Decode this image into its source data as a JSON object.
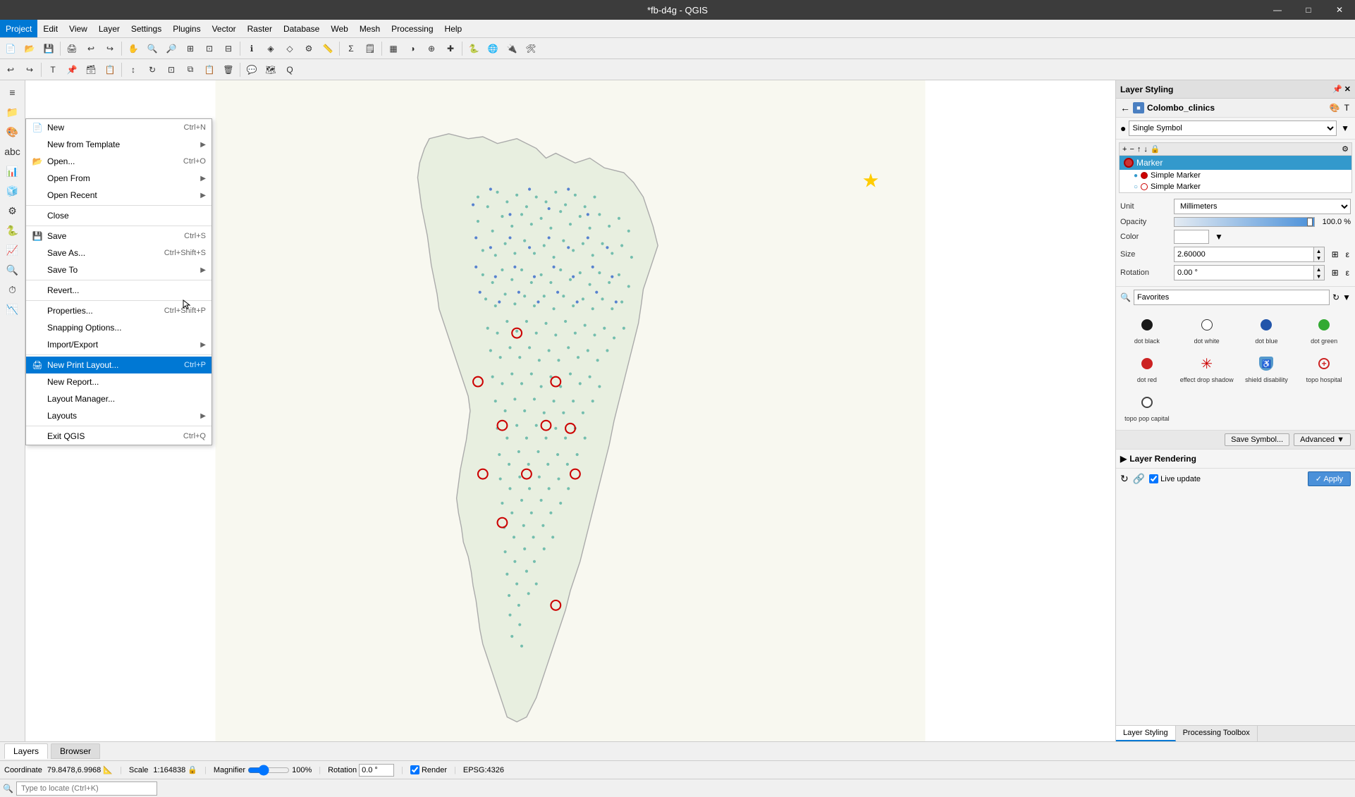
{
  "window": {
    "title": "*fb-d4g - QGIS"
  },
  "window_controls": {
    "minimize": "—",
    "maximize": "□",
    "close": "✕"
  },
  "menubar": {
    "items": [
      "Project",
      "Edit",
      "View",
      "Layer",
      "Settings",
      "Plugins",
      "Vector",
      "Raster",
      "Database",
      "Web",
      "Mesh",
      "Processing",
      "Help"
    ]
  },
  "dropdown": {
    "items": [
      {
        "label": "New",
        "shortcut": "Ctrl+N",
        "icon": "",
        "has_arrow": false,
        "separator_after": false
      },
      {
        "label": "New from Template",
        "shortcut": "",
        "icon": "",
        "has_arrow": true,
        "separator_after": false
      },
      {
        "label": "Open...",
        "shortcut": "Ctrl+O",
        "icon": "",
        "has_arrow": false,
        "separator_after": false
      },
      {
        "label": "Open From",
        "shortcut": "",
        "icon": "",
        "has_arrow": true,
        "separator_after": false
      },
      {
        "label": "Open Recent",
        "shortcut": "",
        "icon": "",
        "has_arrow": true,
        "separator_after": true
      },
      {
        "label": "Close",
        "shortcut": "",
        "icon": "",
        "has_arrow": false,
        "separator_after": true
      },
      {
        "label": "Save",
        "shortcut": "Ctrl+S",
        "icon": "",
        "has_arrow": false,
        "separator_after": false
      },
      {
        "label": "Save As...",
        "shortcut": "Ctrl+Shift+S",
        "icon": "",
        "has_arrow": false,
        "separator_after": false
      },
      {
        "label": "Save To",
        "shortcut": "",
        "icon": "",
        "has_arrow": true,
        "separator_after": true
      },
      {
        "label": "Revert...",
        "shortcut": "",
        "icon": "",
        "has_arrow": false,
        "separator_after": true
      },
      {
        "label": "Properties...",
        "shortcut": "Ctrl+Shift+P",
        "icon": "",
        "has_arrow": false,
        "separator_after": false
      },
      {
        "label": "Snapping Options...",
        "shortcut": "",
        "icon": "",
        "has_arrow": false,
        "separator_after": false
      },
      {
        "label": "Import/Export",
        "shortcut": "",
        "icon": "",
        "has_arrow": true,
        "separator_after": true
      },
      {
        "label": "New Print Layout...",
        "shortcut": "Ctrl+P",
        "icon": "",
        "has_arrow": false,
        "highlighted": true,
        "separator_after": false
      },
      {
        "label": "New Report...",
        "shortcut": "",
        "icon": "",
        "has_arrow": false,
        "separator_after": false
      },
      {
        "label": "Layout Manager...",
        "shortcut": "",
        "icon": "",
        "has_arrow": false,
        "separator_after": false
      },
      {
        "label": "Layouts",
        "shortcut": "",
        "icon": "",
        "has_arrow": true,
        "separator_after": true
      },
      {
        "label": "Exit QGIS",
        "shortcut": "Ctrl+Q",
        "icon": "",
        "has_arrow": false,
        "separator_after": false
      }
    ]
  },
  "right_panel": {
    "header": "Layer Styling",
    "layer_name": "Colombo_clinics",
    "symbol_type": "Single Symbol",
    "symbol_tree": {
      "root": "Marker",
      "children": [
        "Simple Marker",
        "Simple Marker"
      ]
    },
    "properties": {
      "unit_label": "Unit",
      "unit_value": "Millimeters",
      "opacity_label": "Opacity",
      "opacity_value": "100.0 %",
      "color_label": "Color",
      "size_label": "Size",
      "size_value": "2.60000",
      "rotation_label": "Rotation",
      "rotation_value": "0.00 °"
    },
    "favorites": {
      "search_placeholder": "Favorites",
      "symbols": [
        {
          "name": "dot black",
          "type": "dot-black"
        },
        {
          "name": "dot white",
          "type": "dot-white"
        },
        {
          "name": "dot blue",
          "type": "dot-blue"
        },
        {
          "name": "dot green",
          "type": "dot-green"
        },
        {
          "name": "dot red",
          "type": "dot-red"
        },
        {
          "name": "effect drop shadow",
          "type": "effect-drop"
        },
        {
          "name": "shield disability",
          "type": "shield-disability"
        },
        {
          "name": "topo hospital",
          "type": "topo-hospital"
        },
        {
          "name": "topo pop capital",
          "type": "dot-pop-capital"
        }
      ]
    },
    "footer": {
      "save_symbol": "Save Symbol...",
      "advanced": "Advanced"
    },
    "rendering": {
      "label": "Layer Rendering"
    },
    "rendering_footer": {
      "live_update": "Live update",
      "apply": "Apply",
      "arrow": "↗"
    },
    "bottom_tabs": [
      "Layer Styling",
      "Processing Toolbox"
    ]
  },
  "statusbar": {
    "coordinate_label": "Coordinate",
    "coordinate_value": "79.8478,6.9968",
    "scale_label": "Scale",
    "scale_value": "1:164838",
    "magnifier_label": "Magnifier",
    "magnifier_value": "100%",
    "rotation_label": "Rotation",
    "rotation_value": "0.0 °",
    "render_label": "Render",
    "epsg": "EPSG:4326"
  },
  "locate_bar": {
    "placeholder": "Type to locate (Ctrl+K)"
  }
}
